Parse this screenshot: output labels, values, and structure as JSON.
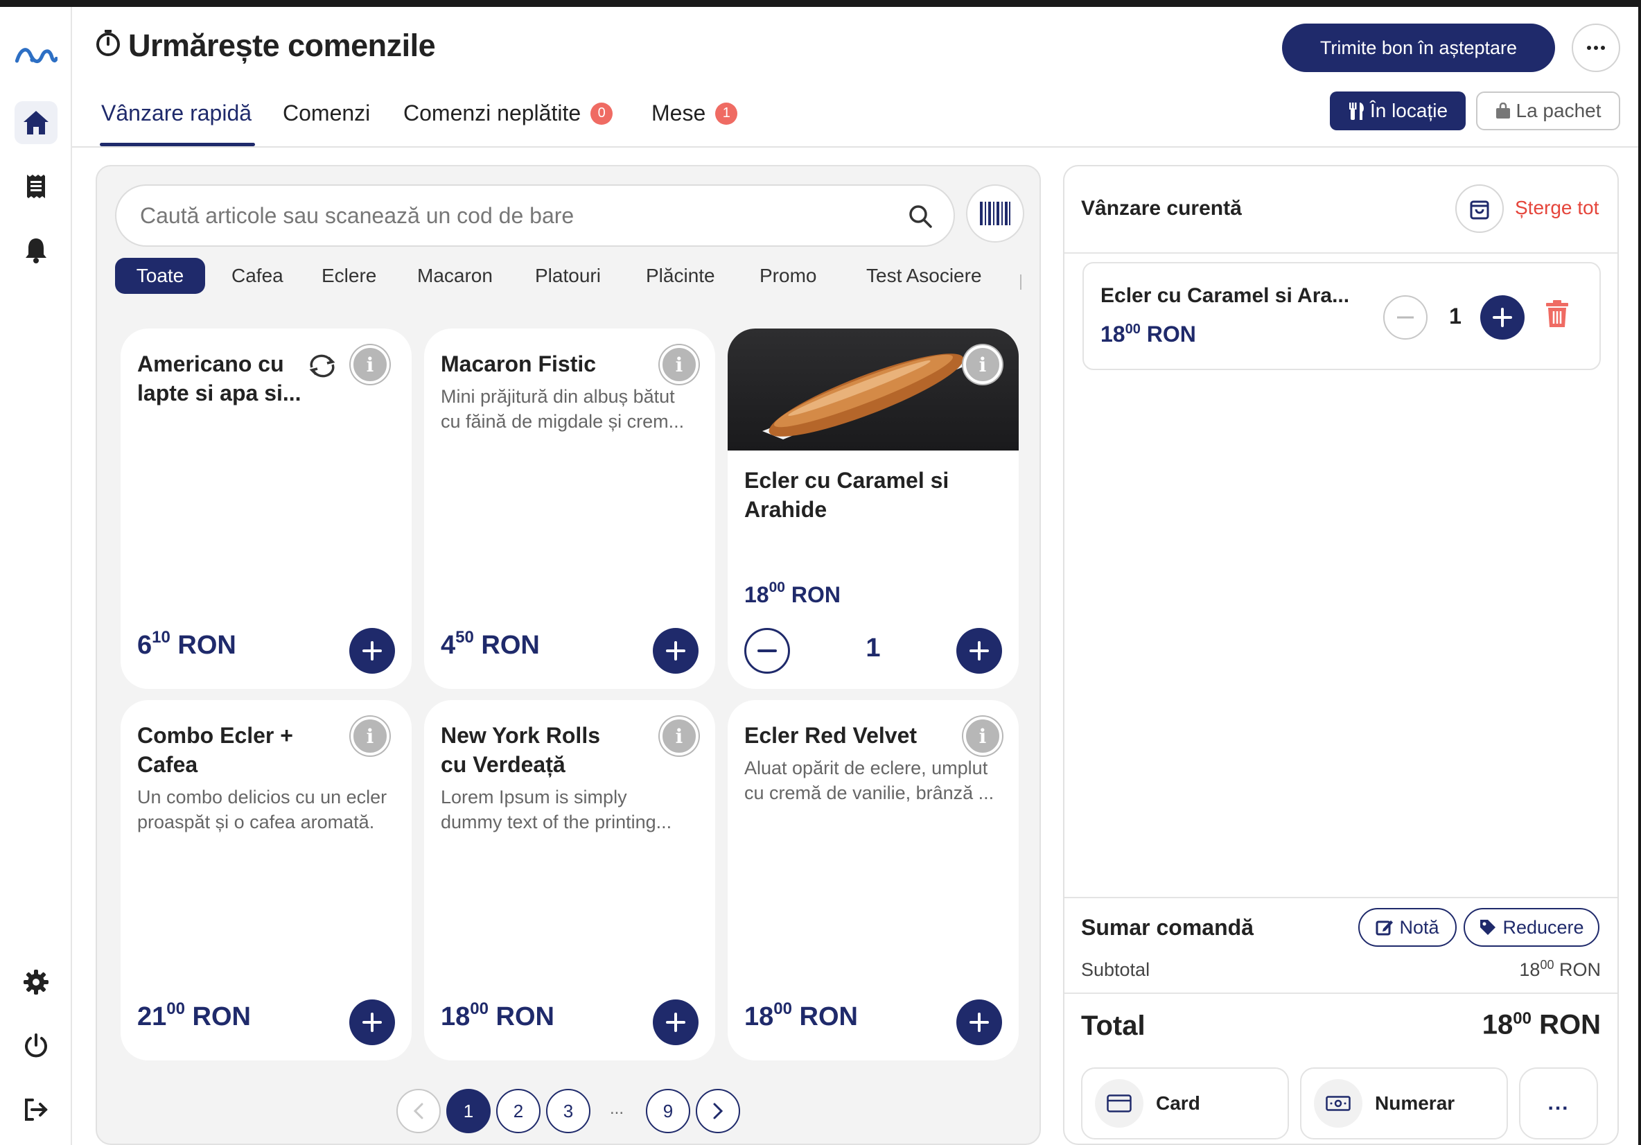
{
  "header": {
    "title": "Urmărește comenzile",
    "send_button": "Trimite bon în așteptare",
    "more_icon": "more-horizontal-icon"
  },
  "tabs": [
    {
      "label": "Vânzare rapidă"
    },
    {
      "label": "Comenzi"
    },
    {
      "label": "Comenzi neplătite",
      "badge": "0"
    },
    {
      "label": "Mese",
      "badge": "1"
    }
  ],
  "mode": {
    "dine_in": "În locație",
    "takeaway": "La pachet"
  },
  "search": {
    "placeholder": "Caută articole sau scanează un cod de bare"
  },
  "categories": [
    "Toate",
    "Cafea",
    "Eclere",
    "Macaron",
    "Platouri",
    "Plăcinte",
    "Promo",
    "Test Asociere"
  ],
  "products": [
    {
      "name": "Americano cu lapte si apa si...",
      "desc": "",
      "price_int": "6",
      "price_dec": "10",
      "currency": "RON"
    },
    {
      "name": "Macaron Fistic",
      "desc1": "Mini prăjitură din albuș bătut",
      "desc2": "cu făină de migdale și crem...",
      "price_int": "4",
      "price_dec": "50",
      "currency": "RON"
    },
    {
      "name": "Ecler cu Caramel si Arahide",
      "price_int": "18",
      "price_dec": "00",
      "currency": "RON",
      "qty": "1"
    },
    {
      "name": "Combo Ecler + Cafea",
      "desc1": "Un combo delicios cu un ecler",
      "desc2": "proaspăt și o cafea aromată.",
      "price_int": "21",
      "price_dec": "00",
      "currency": "RON"
    },
    {
      "name": "New York Rolls cu Verdeață",
      "desc1": "Lorem Ipsum is simply",
      "desc2": "dummy text of the printing...",
      "price_int": "18",
      "price_dec": "00",
      "currency": "RON"
    },
    {
      "name": "Ecler Red Velvet",
      "desc1": "Aluat opărit de eclere, umplut",
      "desc2": "cu cremă de vanilie, brânză ...",
      "price_int": "18",
      "price_dec": "00",
      "currency": "RON"
    }
  ],
  "pagination": {
    "pages": [
      "1",
      "2",
      "3"
    ],
    "ellipsis": "...",
    "last": "9",
    "current": "1"
  },
  "cart": {
    "title": "Vânzare curentă",
    "clear": "Șterge tot",
    "item": {
      "name": "Ecler cu Caramel si Ara...",
      "price_int": "18",
      "price_dec": "00",
      "currency": "RON",
      "qty": "1"
    },
    "summary_title": "Sumar comandă",
    "note": "Notă",
    "discount": "Reducere",
    "subtotal_label": "Subtotal",
    "subtotal_int": "18",
    "subtotal_dec": "00",
    "subtotal_currency": "RON",
    "total_label": "Total",
    "total_int": "18",
    "total_dec": "00",
    "total_currency": "RON",
    "pay_card": "Card",
    "pay_cash": "Numerar",
    "pay_more": "..."
  },
  "colors": {
    "primary": "#1f2a6b",
    "danger": "#e5453b",
    "badge": "#ef6b63"
  }
}
